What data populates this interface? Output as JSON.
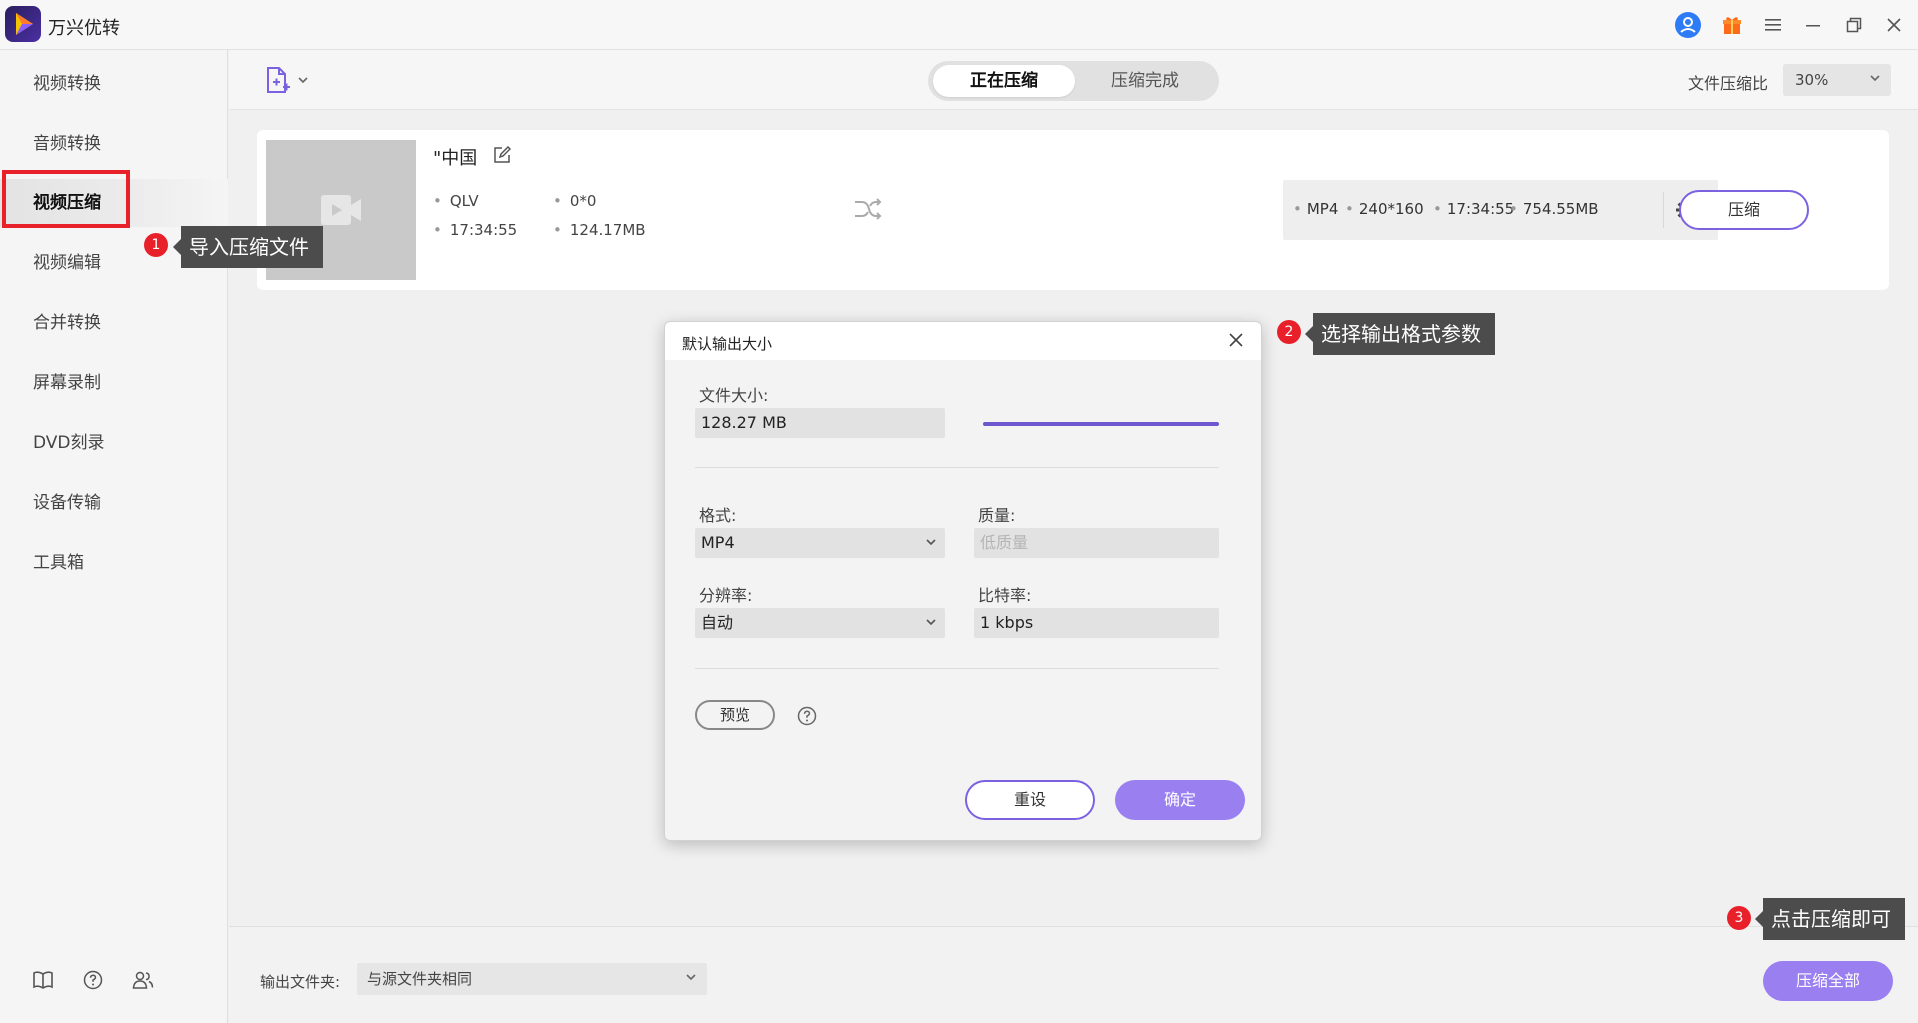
{
  "app": {
    "title": "万兴优转"
  },
  "sidebar": {
    "items": [
      {
        "label": "视频转换"
      },
      {
        "label": "音频转换"
      },
      {
        "label": "视频压缩"
      },
      {
        "label": "视频编辑"
      },
      {
        "label": "合并转换"
      },
      {
        "label": "屏幕录制"
      },
      {
        "label": "DVD刻录"
      },
      {
        "label": "设备传输"
      },
      {
        "label": "工具箱"
      }
    ],
    "active_item": "视频压缩"
  },
  "toolbar": {
    "tabs": [
      {
        "label": "正在压缩"
      },
      {
        "label": "压缩完成"
      }
    ],
    "active_tab": "正在压缩",
    "ratio_label": "文件压缩比",
    "ratio_value": "30%"
  },
  "file": {
    "name": "\"中国",
    "source": {
      "format": "QLV",
      "resolution": "0*0",
      "duration": "17:34:55",
      "size": "124.17MB"
    },
    "output": {
      "format": "MP4",
      "resolution": "240*160",
      "duration": "17:34:55",
      "size": "754.55MB"
    },
    "compress_label": "压缩"
  },
  "dialog": {
    "title": "默认输出大小",
    "file_size_label": "文件大小:",
    "file_size_value": "128.27 MB",
    "size_slider_level": 1.0,
    "format_label": "格式:",
    "format_value": "MP4",
    "quality_label": "质量:",
    "quality_placeholder": "低质量",
    "resolution_label": "分辨率:",
    "resolution_value": "自动",
    "bitrate_label": "比特率:",
    "bitrate_value": "1 kbps",
    "preview_label": "预览",
    "reset_label": "重设",
    "ok_label": "确定"
  },
  "bottom": {
    "output_folder_label": "输出文件夹:",
    "output_folder_value": "与源文件夹相同",
    "compress_all_label": "压缩全部"
  },
  "callouts": [
    {
      "number": "1",
      "text": "导入压缩文件"
    },
    {
      "number": "2",
      "text": "选择输出格式参数"
    },
    {
      "number": "3",
      "text": "点击压缩即可"
    }
  ],
  "colors": {
    "accent": "#7c62e0",
    "accent_fill": "#9a7ff0",
    "highlight_red": "#e8202a",
    "slider": "#6e56cf"
  }
}
